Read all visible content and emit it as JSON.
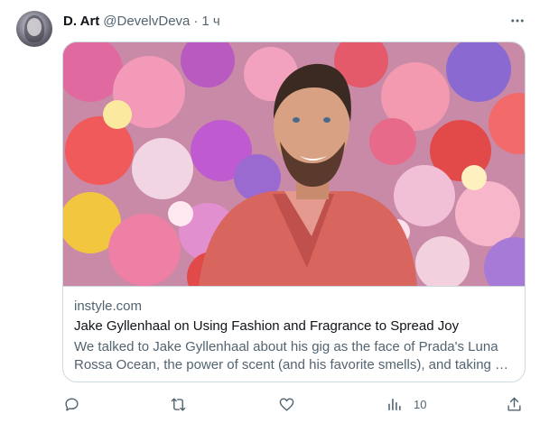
{
  "tweet": {
    "author_name": "D. Art",
    "handle": "@DevelvDeva",
    "separator": "·",
    "time": "1 ч"
  },
  "card": {
    "domain": "instyle.com",
    "title": "Jake Gyllenhaal on Using Fashion and Fragrance to Spread Joy",
    "description": "We talked to Jake Gyllenhaal about his gig as the face of Prada's Luna Rossa Ocean, the power of scent (and his favorite smells), and taking …"
  },
  "actions": {
    "views_count": "10"
  },
  "icons": {
    "more": "more-dots-icon",
    "reply": "reply-icon",
    "retweet": "retweet-icon",
    "like": "heart-icon",
    "views": "views-chart-icon",
    "share": "share-icon"
  },
  "colors": {
    "text_primary": "#0f1419",
    "text_secondary": "#536471",
    "border": "#cfd9de",
    "jacket": "#d9665e"
  }
}
